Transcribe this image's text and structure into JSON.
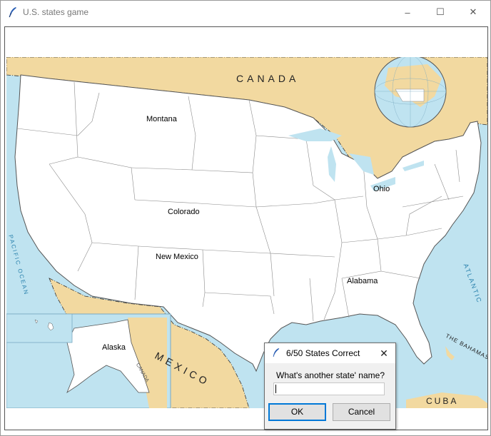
{
  "window": {
    "title": "U.S. states game",
    "controls": {
      "minimize": "–",
      "maximize": "☐",
      "close": "✕"
    }
  },
  "map": {
    "region_labels": {
      "canada": "CANADA",
      "mexico": "MEXICO",
      "cuba": "CUBA",
      "bahamas": "THE BAHAMAS",
      "atlantic": "ATLANTIC",
      "pacific": "PACIFIC OCEAN",
      "alaska_canada": "CANADA"
    },
    "guessed_states": [
      {
        "name": "Montana"
      },
      {
        "name": "Colorado"
      },
      {
        "name": "New Mexico"
      },
      {
        "name": "Ohio"
      },
      {
        "name": "Alabama"
      },
      {
        "name": "Alaska"
      }
    ],
    "colors": {
      "water": "#bfe3f0",
      "land_foreign": "#f2d9a0",
      "us_land": "#ffffff",
      "border": "#8a8a8a"
    }
  },
  "dialog": {
    "title": "6/50 States Correct",
    "prompt": "What's another state' name?",
    "input_value": "",
    "ok_label": "OK",
    "cancel_label": "Cancel",
    "close": "✕"
  }
}
